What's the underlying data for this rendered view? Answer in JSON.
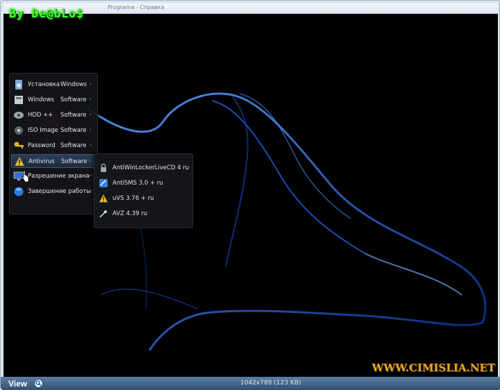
{
  "window": {
    "title": "Programa · Справка"
  },
  "watermarks": {
    "top": "By De@bLo$",
    "bottom": "WWW.CIMISLIA.NET"
  },
  "menu": {
    "items": [
      {
        "l1": "Установка",
        "l2": "Windows",
        "icon": "disk-icon",
        "active": false
      },
      {
        "l1": "Windows",
        "l2": "Software",
        "icon": "windows-icon",
        "active": false
      },
      {
        "l1": "HDD ++",
        "l2": "Software",
        "icon": "hdd-icon",
        "active": false
      },
      {
        "l1": "ISO Image",
        "l2": "Software",
        "icon": "iso-image-icon",
        "active": false
      },
      {
        "l1": "Password",
        "l2": "Software",
        "icon": "key-icon",
        "active": false
      },
      {
        "l1": "Antivirus",
        "l2": "Software",
        "icon": "warning-icon",
        "active": true
      },
      {
        "l1": "Разрешение экрана",
        "l2": "",
        "icon": "monitor-icon",
        "active": false
      },
      {
        "l1": "Завершение работы",
        "l2": "",
        "icon": "shutdown-orb-icon",
        "active": false
      }
    ],
    "arrow": "›"
  },
  "submenu": {
    "items": [
      {
        "label": "AntiWinLockerLiveCD 4 ru",
        "icon": "lock-icon"
      },
      {
        "label": "AntiSMS 3.0 + ru",
        "icon": "antisms-icon"
      },
      {
        "label": "uVS 3.76 + ru",
        "icon": "warning-icon"
      },
      {
        "label": "AVZ 4.39 ru",
        "icon": "wand-icon"
      }
    ]
  },
  "statusbar": {
    "view_label": "View",
    "info": "1042x789 (123 KB)"
  },
  "colors": {
    "accent_green": "#46ff1a",
    "accent_orange": "#f0a31a",
    "statusbar": "#3f6189"
  }
}
